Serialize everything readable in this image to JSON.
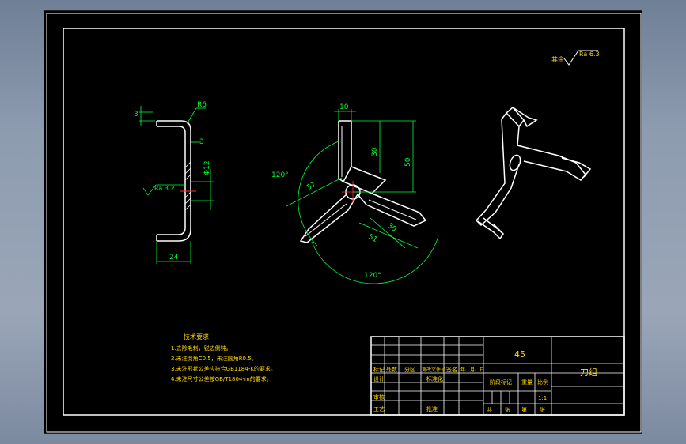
{
  "roughness_note": {
    "prefix": "其余",
    "value": "Ra 6.3"
  },
  "side_view": {
    "dim_top_thickness": "3",
    "dim_radius": "R6",
    "dim_thickness": "3",
    "dim_hole": "Φ12",
    "roughness": "Ra 3.2",
    "dim_width": "24"
  },
  "front_view": {
    "dim_blade_width": "10",
    "dim_30": "30",
    "dim_50": "50",
    "dim_51_left": "51",
    "dim_51_right": "51",
    "dim_30_right": "30",
    "angle_left": "120°",
    "angle_bottom": "120°"
  },
  "tech_requirements": {
    "title": "技术要求",
    "items": [
      "1.去除毛刺，锐边倒钝。",
      "2.未注倒角C0.5，未注圆角R0.5。",
      "3.未注形状公差应符合GB1184-K的要求。",
      "4.未注尺寸公差按GB/T1804-m的要求。"
    ]
  },
  "title_block": {
    "header_labels": [
      "标记",
      "处数",
      "分区",
      "更改文件号",
      "签名",
      "年、月、日"
    ],
    "design_label": "设计",
    "standardize_label": "标准化",
    "review_label": "审核",
    "process_label": "工艺",
    "approve_label": "批准",
    "material": "45",
    "part_name": "刀组",
    "stage_label": "阶段标记",
    "weight_label": "重量",
    "scale_label": "比例",
    "scale_value": "1:1",
    "sheets_total_label": "共",
    "sheets_label_1": "张",
    "sheet_no_label": "第",
    "sheets_label_2": "张"
  }
}
